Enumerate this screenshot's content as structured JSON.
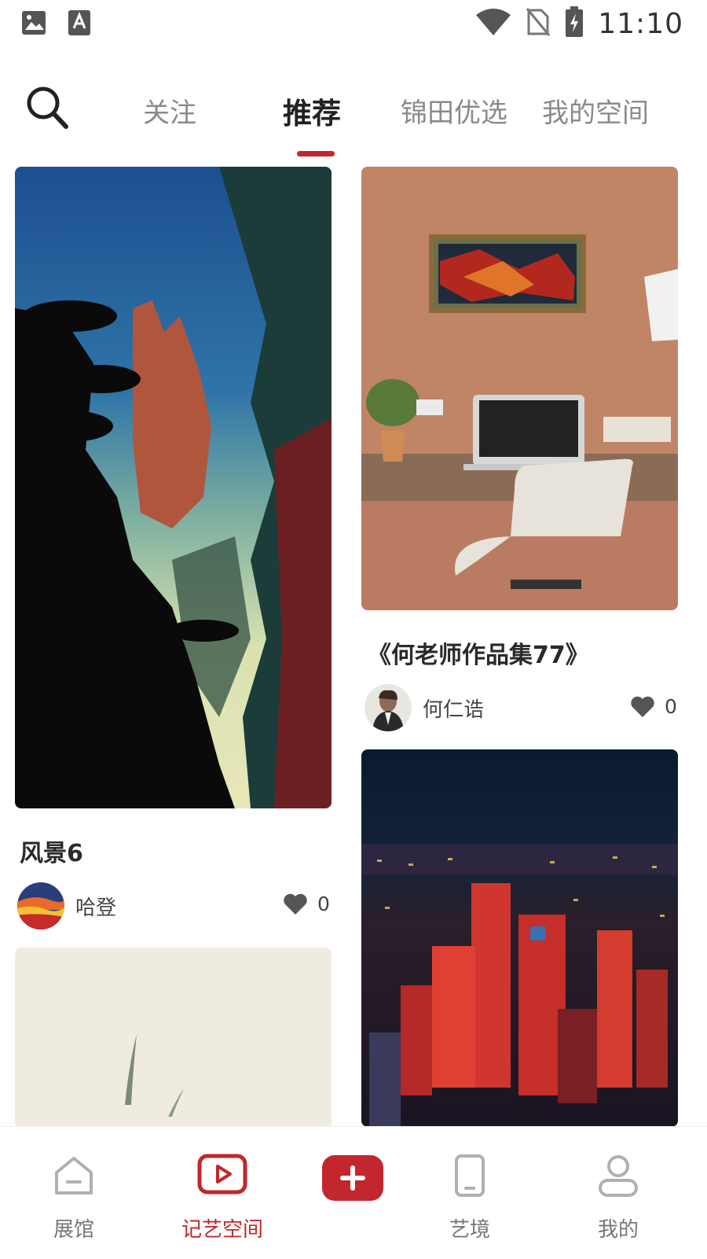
{
  "status_bar": {
    "time": "11:10"
  },
  "header": {
    "tabs": [
      {
        "label": "关注"
      },
      {
        "label": "推荐",
        "active": true
      },
      {
        "label": "锦田优选"
      },
      {
        "label": "我的空间"
      }
    ]
  },
  "feed": {
    "cards": [
      {
        "title": "风景6",
        "author": "哈登",
        "likes": "0"
      },
      {
        "title": "《何老师作品集77》",
        "author": "何仁诰",
        "likes": "0"
      }
    ]
  },
  "bottom_nav": {
    "items": [
      {
        "label": "展馆",
        "icon": "museum-icon"
      },
      {
        "label": "记艺空间",
        "icon": "play-icon",
        "active": true
      },
      {
        "label": "",
        "icon": "add-icon"
      },
      {
        "label": "艺境",
        "icon": "phone-icon"
      },
      {
        "label": "我的",
        "icon": "profile-icon"
      }
    ]
  },
  "colors": {
    "accent": "#c1272d",
    "inactive": "#8a8a8a",
    "text": "#222222"
  }
}
